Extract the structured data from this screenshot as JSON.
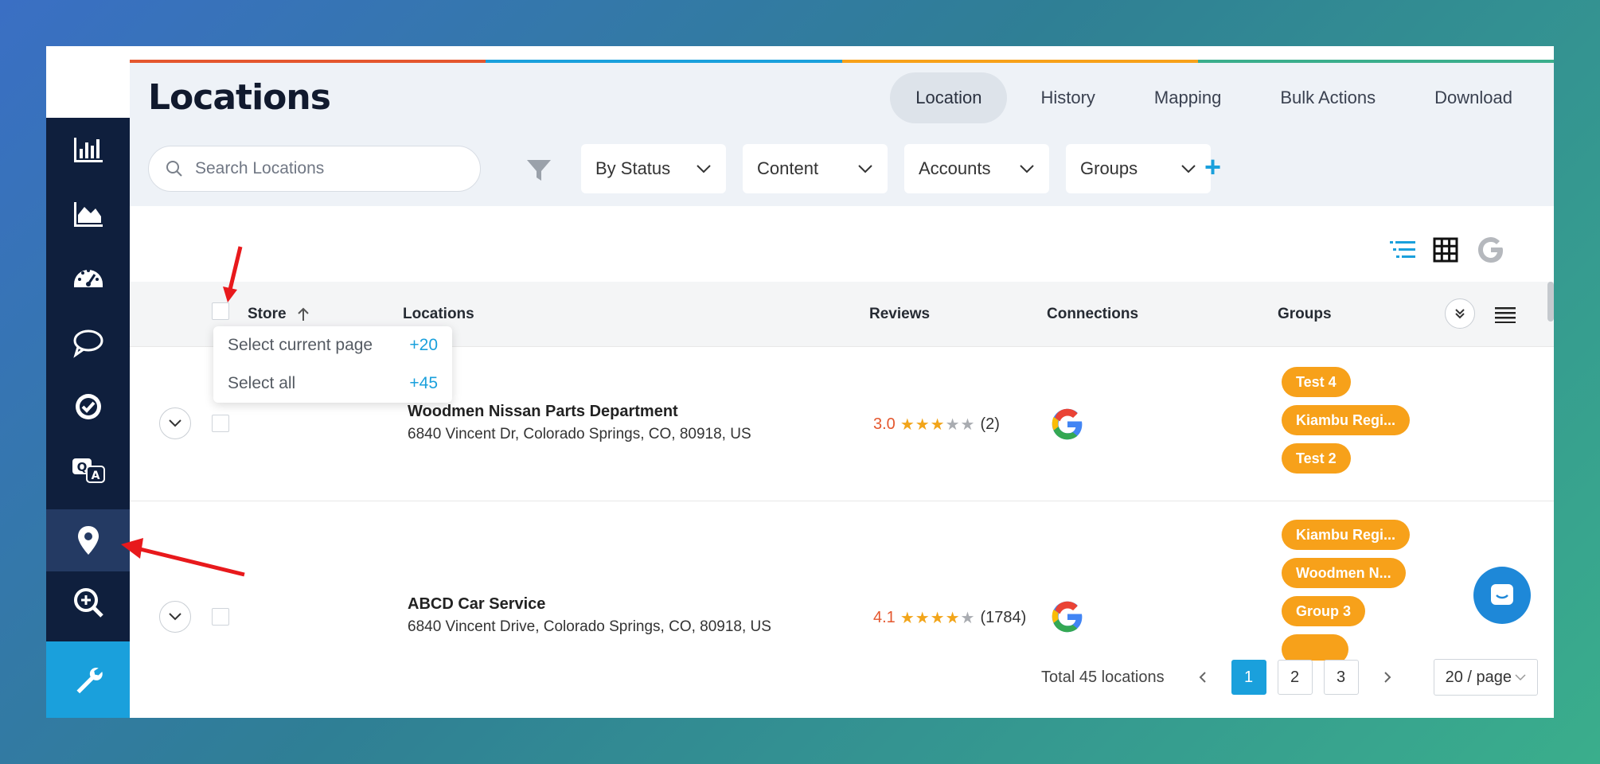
{
  "header": {
    "title": "Locations",
    "tabs": [
      {
        "label": "Location",
        "active": true
      },
      {
        "label": "History"
      },
      {
        "label": "Mapping"
      },
      {
        "label": "Bulk Actions"
      },
      {
        "label": "Download"
      }
    ]
  },
  "filters": {
    "search_placeholder": "Search Locations",
    "dropdowns": [
      "By Status",
      "Content",
      "Accounts",
      "Groups"
    ],
    "add_label": "+"
  },
  "table": {
    "columns": {
      "store": "Store",
      "locations": "Locations",
      "reviews": "Reviews",
      "connections": "Connections",
      "groups": "Groups"
    },
    "select_popup": [
      {
        "label": "Select current page",
        "count": "+20"
      },
      {
        "label": "Select all",
        "count": "+45"
      }
    ],
    "rows": [
      {
        "name": "Woodmen Nissan Parts Department",
        "address": "6840 Vincent Dr, Colorado Springs, CO, 80918, US",
        "rating": "3.0",
        "stars": 3,
        "review_count": "(2)",
        "groups": [
          "Test 4",
          "Kiambu Regi...",
          "Test 2"
        ]
      },
      {
        "name": "ABCD Car Service",
        "address": "6840 Vincent Drive, Colorado Springs, CO, 80918, US",
        "rating": "4.1",
        "stars": 4,
        "review_count": "(1784)",
        "groups": [
          "Kiambu Regi...",
          "Woodmen N...",
          "Group 3"
        ]
      }
    ]
  },
  "pagination": {
    "total": "Total 45 locations",
    "pages": [
      "1",
      "2",
      "3"
    ],
    "current": "1",
    "page_size": "20 / page"
  },
  "colors": {
    "sidebar": "#0f1f3d",
    "accent": "#1aa0dc",
    "pill": "#f7a11a",
    "stripe": [
      "#e4572e",
      "#1aa0dc",
      "#f7a11a",
      "#3aae8c"
    ]
  }
}
